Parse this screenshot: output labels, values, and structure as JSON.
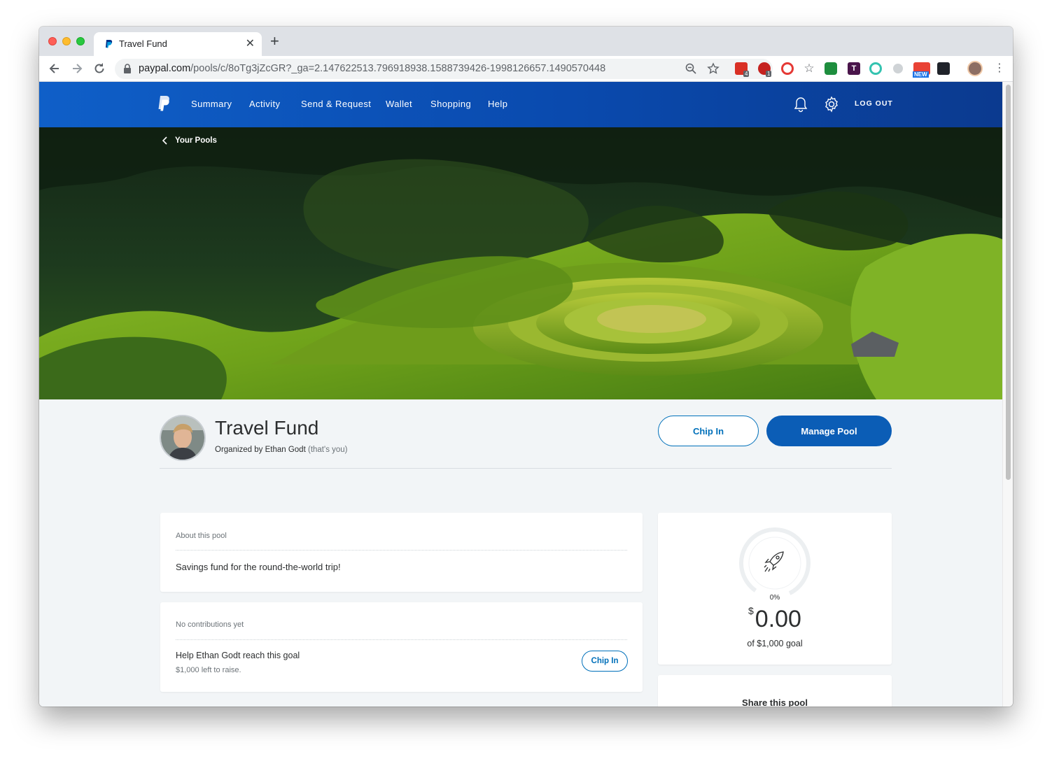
{
  "browser": {
    "tab_title": "Travel Fund",
    "url_host": "paypal.com",
    "url_path": "/pools/c/8oTg3jZcGR?_ga=2.147622513.796918938.1588739426-1998126657.1490570448",
    "extension_badges": [
      "4",
      "1"
    ],
    "extension_new_label": "NEW",
    "extension_t_label": "T"
  },
  "header": {
    "nav": [
      "Summary",
      "Activity",
      "Send & Request",
      "Wallet",
      "Shopping",
      "Help"
    ],
    "logout": "LOG OUT"
  },
  "hero": {
    "back_label": "Your Pools"
  },
  "pool": {
    "title": "Travel Fund",
    "organizer_prefix": "Organized by Ethan Godt",
    "organizer_suffix": "(that's you)",
    "chip_in_label": "Chip In",
    "manage_label": "Manage Pool"
  },
  "about": {
    "label": "About this pool",
    "text": "Savings fund for the round-the-world trip!"
  },
  "contributions": {
    "label": "No contributions yet",
    "help_title": "Help Ethan Godt reach this goal",
    "help_sub": "$1,000 left to raise.",
    "chip_in_label": "Chip In"
  },
  "progress": {
    "percent_label": "0%",
    "percent": 0,
    "currency_symbol": "$",
    "amount": "0.00",
    "goal_label": "of $1,000 goal"
  },
  "share": {
    "title": "Share this pool"
  },
  "colors": {
    "brand_blue": "#0070ba",
    "header_blue": "#0a4aae",
    "page_bg": "#f2f5f7"
  }
}
